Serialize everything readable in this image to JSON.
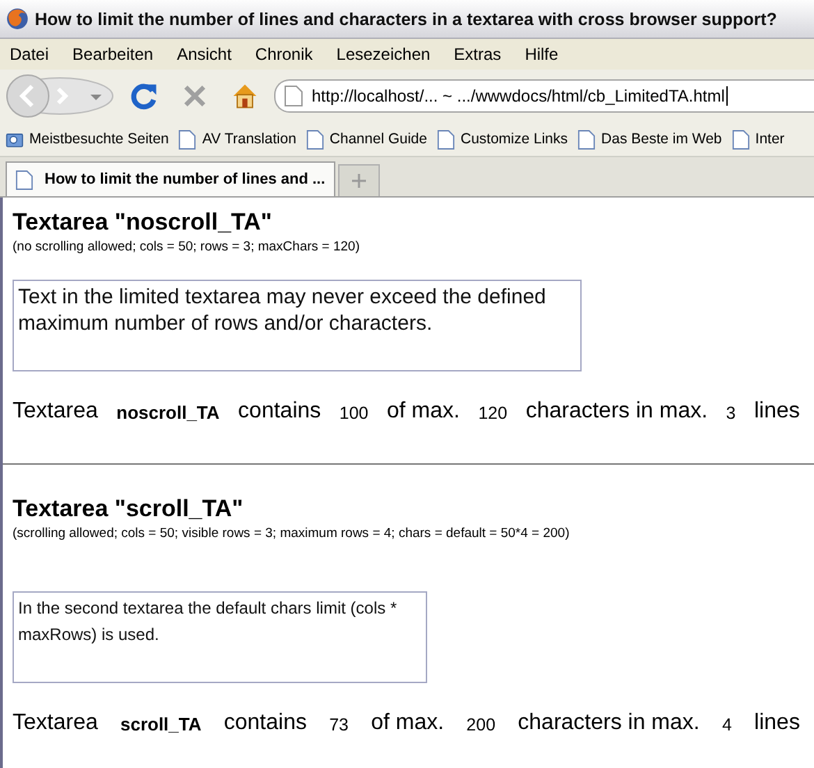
{
  "window": {
    "title": "How to limit the number of lines and characters in a textarea with cross browser support?"
  },
  "menu": [
    "Datei",
    "Bearbeiten",
    "Ansicht",
    "Chronik",
    "Lesezeichen",
    "Extras",
    "Hilfe"
  ],
  "address_bar": {
    "value": "http://localhost/... ~ .../wwwdocs/html/cb_LimitedTA.html"
  },
  "bookmarks": [
    {
      "label": "Meistbesuchte Seiten",
      "kind": "smart"
    },
    {
      "label": "AV Translation",
      "kind": "page"
    },
    {
      "label": "Channel Guide",
      "kind": "page"
    },
    {
      "label": "Customize Links",
      "kind": "page"
    },
    {
      "label": "Das Beste im Web",
      "kind": "page"
    },
    {
      "label": "Inter",
      "kind": "page"
    }
  ],
  "tabs": [
    {
      "label": "How to limit the number of lines and ...",
      "selected": true
    }
  ],
  "sections": [
    {
      "heading": "Textarea \"noscroll_TA\"",
      "note": "(no scrolling allowed; cols = 50; rows = 3; maxChars = 120)",
      "textarea": {
        "value": "Text in the limited textarea may never exceed the defined maximum number of rows and/or characters.",
        "kind": "large"
      },
      "status": [
        {
          "text": "Textarea",
          "kind": "label"
        },
        {
          "text": "noscroll_TA",
          "kind": "name"
        },
        {
          "text": "contains",
          "kind": "label"
        },
        {
          "text": "100",
          "kind": "value"
        },
        {
          "text": "of max.",
          "kind": "label"
        },
        {
          "text": "120",
          "kind": "value"
        },
        {
          "text": "characters in max.",
          "kind": "label"
        },
        {
          "text": "3",
          "kind": "value"
        },
        {
          "text": "lines",
          "kind": "label"
        }
      ]
    },
    {
      "heading": "Textarea \"scroll_TA\"",
      "note": "(scrolling allowed; cols = 50; visible rows = 3; maximum rows = 4; chars = default = 50*4 = 200)",
      "textarea": {
        "value": "In the second textarea the default chars limit (cols * maxRows) is used.",
        "kind": "small"
      },
      "status": [
        {
          "text": "Textarea",
          "kind": "label"
        },
        {
          "text": "scroll_TA",
          "kind": "name"
        },
        {
          "text": "contains",
          "kind": "label"
        },
        {
          "text": "73",
          "kind": "value"
        },
        {
          "text": "of max.",
          "kind": "label"
        },
        {
          "text": "200",
          "kind": "value"
        },
        {
          "text": "characters in max.",
          "kind": "label"
        },
        {
          "text": "4",
          "kind": "value"
        },
        {
          "text": "lines",
          "kind": "label"
        }
      ]
    }
  ]
}
